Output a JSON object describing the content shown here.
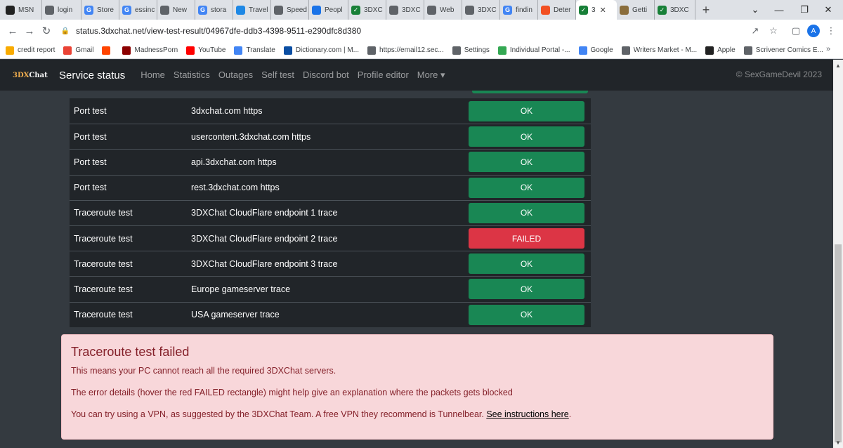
{
  "tabs": [
    {
      "label": "MSN",
      "icon": "msn-icon",
      "color": "#222"
    },
    {
      "label": "login",
      "icon": "globe-icon",
      "color": "#5f6368"
    },
    {
      "label": "Store",
      "icon": "google-icon",
      "color": "#4285f4"
    },
    {
      "label": "essinc",
      "icon": "google-icon",
      "color": "#4285f4"
    },
    {
      "label": "New",
      "icon": "globe-icon",
      "color": "#5f6368"
    },
    {
      "label": "stora",
      "icon": "google-icon",
      "color": "#4285f4"
    },
    {
      "label": "Travel",
      "icon": "travel-icon",
      "color": "#1e88e5"
    },
    {
      "label": "Speed",
      "icon": "speedometer-icon",
      "color": "#5f6368"
    },
    {
      "label": "Peopl",
      "icon": "people-icon",
      "color": "#1a73e8"
    },
    {
      "label": "3DXC",
      "icon": "check-icon",
      "color": "#188038"
    },
    {
      "label": "3DXC",
      "icon": "globe-icon",
      "color": "#5f6368"
    },
    {
      "label": "Web",
      "icon": "globe-icon",
      "color": "#5f6368"
    },
    {
      "label": "3DXC",
      "icon": "globe-icon",
      "color": "#5f6368"
    },
    {
      "label": "findin",
      "icon": "google-icon",
      "color": "#4285f4"
    },
    {
      "label": "Deter",
      "icon": "microsoft-icon",
      "color": "#f25022"
    },
    {
      "label": "3",
      "icon": "check-icon",
      "color": "#188038",
      "active": true
    },
    {
      "label": "Getti",
      "icon": "scrivener-icon",
      "color": "#8a6d3b"
    },
    {
      "label": "3DXC",
      "icon": "check-icon",
      "color": "#188038"
    }
  ],
  "address_bar": {
    "url": "status.3dxchat.net/view-test-result/04967dfe-ddb3-4398-9511-e290dfc8d380"
  },
  "bookmarks": [
    {
      "label": "credit report",
      "icon": "bookmark-icon",
      "color": "#f9ab00"
    },
    {
      "label": "Gmail",
      "icon": "gmail-icon",
      "color": "#ea4335"
    },
    {
      "label": "",
      "icon": "reddit-icon",
      "color": "#ff4500"
    },
    {
      "label": "MadnessPorn",
      "icon": "madness-icon",
      "color": "#8b0000"
    },
    {
      "label": "YouTube",
      "icon": "youtube-icon",
      "color": "#ff0000"
    },
    {
      "label": "Translate",
      "icon": "translate-icon",
      "color": "#4285f4"
    },
    {
      "label": "Dictionary.com | M...",
      "icon": "dictionary-icon",
      "color": "#0a4ea3"
    },
    {
      "label": "https://email12.sec...",
      "icon": "globe-icon",
      "color": "#5f6368"
    },
    {
      "label": "Settings",
      "icon": "gear-icon",
      "color": "#5f6368"
    },
    {
      "label": "Individual Portal -...",
      "icon": "portal-icon",
      "color": "#34a853"
    },
    {
      "label": "Google",
      "icon": "google-icon",
      "color": "#4285f4"
    },
    {
      "label": "Writers Market - M...",
      "icon": "globe-icon",
      "color": "#5f6368"
    },
    {
      "label": "Apple",
      "icon": "apple-icon",
      "color": "#222"
    },
    {
      "label": "Scrivener Comics E...",
      "icon": "globe-icon",
      "color": "#5f6368"
    }
  ],
  "site": {
    "logo_text_left": "3DX",
    "logo_text_right": "Chat",
    "brand": "Service status",
    "nav": [
      "Home",
      "Statistics",
      "Outages",
      "Self test",
      "Discord bot",
      "Profile editor",
      "More ▾"
    ],
    "copyright": "© SexGameDevil 2023"
  },
  "results": [
    {
      "type": "Port test",
      "target": "3dxchat.com https",
      "status": "OK"
    },
    {
      "type": "Port test",
      "target": "usercontent.3dxchat.com https",
      "status": "OK"
    },
    {
      "type": "Port test",
      "target": "api.3dxchat.com https",
      "status": "OK"
    },
    {
      "type": "Port test",
      "target": "rest.3dxchat.com https",
      "status": "OK"
    },
    {
      "type": "Traceroute test",
      "target": "3DXChat CloudFlare endpoint 1 trace",
      "status": "OK"
    },
    {
      "type": "Traceroute test",
      "target": "3DXChat CloudFlare endpoint 2 trace",
      "status": "FAILED"
    },
    {
      "type": "Traceroute test",
      "target": "3DXChat CloudFlare endpoint 3 trace",
      "status": "OK"
    },
    {
      "type": "Traceroute test",
      "target": "Europe gameserver trace",
      "status": "OK"
    },
    {
      "type": "Traceroute test",
      "target": "USA gameserver trace",
      "status": "OK"
    }
  ],
  "alert": {
    "title": "Traceroute test failed",
    "line1": "This means your PC cannot reach all the required 3DXChat servers.",
    "line2": "The error details (hover the red FAILED rectangle) might help give an explanation where the packets gets blocked",
    "line3": "You can try using a VPN, as suggested by the 3DXChat Team. A free VPN they recommend is Tunnelbear. ",
    "link": "See instructions here",
    "line3_end": "."
  },
  "colors": {
    "ok": "#198754",
    "failed": "#dc3545",
    "alert_bg": "#f8d7da",
    "alert_text": "#842029",
    "nav_bg": "#212529"
  }
}
